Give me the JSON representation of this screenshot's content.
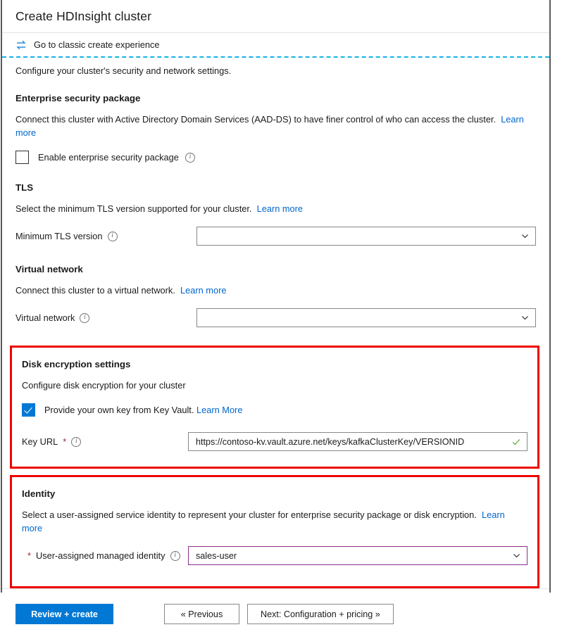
{
  "header": {
    "title": "Create HDInsight cluster"
  },
  "classic": {
    "icon": "swap-arrows-icon",
    "label": "Go to classic create experience"
  },
  "lead_text": "Configure your cluster's security and network settings.",
  "sections": {
    "enterprise_security": {
      "heading": "Enterprise security package",
      "description": "Connect this cluster with Active Directory Domain Services (AAD-DS) to have finer control of who can access the cluster.",
      "link_label": "Learn more",
      "checkbox": {
        "label": "Enable enterprise security package",
        "checked": false,
        "info_icon": "info-icon"
      }
    },
    "tls": {
      "heading": "TLS",
      "description": "Select the minimum TLS version supported for your cluster.",
      "link_label": "Learn more",
      "field": {
        "label": "Minimum TLS version",
        "value": "",
        "info_icon": "info-icon",
        "chevron_icon": "chevron-down-icon"
      }
    },
    "virtual_network": {
      "heading": "Virtual network",
      "description": "Connect this cluster to a virtual network.",
      "link_label": "Learn more",
      "field": {
        "label": "Virtual network",
        "value": "",
        "info_icon": "info-icon",
        "chevron_icon": "chevron-down-icon"
      }
    },
    "disk_encryption": {
      "heading": "Disk encryption settings",
      "description": "Configure disk encryption for your cluster",
      "checkbox": {
        "label": "Provide your own key from Key Vault.",
        "link_label": "Learn More",
        "checked": true
      },
      "key_url": {
        "label": "Key URL",
        "required_marker": "*",
        "value": "https://contoso-kv.vault.azure.net/keys/kafkaClusterKey/VERSIONID",
        "info_icon": "info-icon",
        "validation_icon": "green-check-icon"
      },
      "highlight_color": "#ee0000"
    },
    "identity": {
      "heading": "Identity",
      "description": "Select a user-assigned service identity to represent your cluster for enterprise security package or disk encryption.",
      "link_label": "Learn more",
      "field": {
        "required_marker": "*",
        "label": "User-assigned managed identity",
        "value": "sales-user",
        "info_icon": "info-icon",
        "chevron_icon": "chevron-down-icon",
        "border_color": "#8a2f8a"
      },
      "highlight_color": "#ee0000"
    }
  },
  "footer": {
    "review_create": "Review + create",
    "previous": "« Previous",
    "next": "Next: Configuration + pricing »"
  },
  "colors": {
    "accent": "#0078d4",
    "link": "#0066cc",
    "highlight": "#ee0000",
    "valid": "#5aa82e",
    "required": "#a4262c"
  }
}
